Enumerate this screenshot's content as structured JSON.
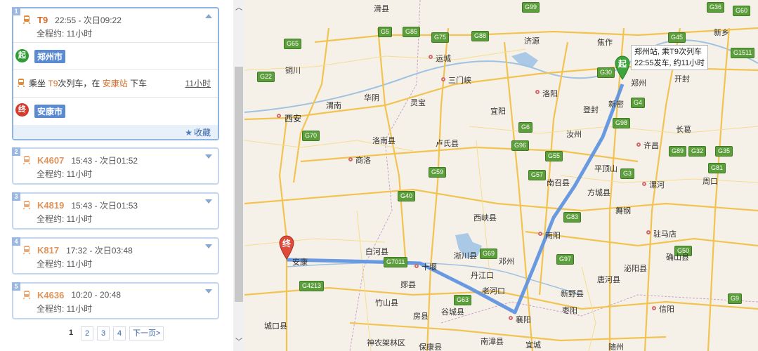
{
  "routes": [
    {
      "index": "1",
      "train": "T9",
      "time": "22:55 - 次日09:22",
      "duration": "全程约: 11小时"
    },
    {
      "index": "2",
      "train": "K4607",
      "time": "15:43 - 次日01:52",
      "duration": "全程约: 11小时"
    },
    {
      "index": "3",
      "train": "K4819",
      "time": "15:43 - 次日01:53",
      "duration": "全程约: 11小时"
    },
    {
      "index": "4",
      "train": "K817",
      "time": "17:32 - 次日03:48",
      "duration": "全程约: 11小时"
    },
    {
      "index": "5",
      "train": "K4636",
      "time": "10:20 - 20:48",
      "duration": "全程约: 11小时"
    }
  ],
  "detail": {
    "start_badge": "起",
    "start_city": "郑州市",
    "ride_prefix": "乘坐",
    "ride_train": "T9",
    "ride_mid": "次列车，在",
    "ride_station": "安康站",
    "ride_suffix": "下车",
    "ride_duration": "11小时",
    "end_badge": "终",
    "end_city": "安康市",
    "favorite": "收藏"
  },
  "pager": {
    "pages": [
      "1",
      "2",
      "3",
      "4"
    ],
    "next": "下一页>"
  },
  "map": {
    "tooltip_line1": "郑州站, 乘T9次列车",
    "tooltip_line2": "22:55发车, 约11小时",
    "start_marker": "起",
    "end_marker": "终",
    "cities": [
      {
        "id": "zhengzhou",
        "label": "郑州"
      },
      {
        "id": "xian",
        "label": "西安"
      },
      {
        "id": "ankang",
        "label": "安康"
      },
      {
        "id": "xiangyang",
        "label": "襄阳"
      },
      {
        "id": "nanyang",
        "label": "南阳"
      },
      {
        "id": "luoyang",
        "label": "洛阳"
      },
      {
        "id": "shiyan",
        "label": "十堰"
      },
      {
        "id": "pingdingshan",
        "label": "平顶山"
      },
      {
        "id": "sanmenxia",
        "label": "三门峡"
      },
      {
        "id": "yuncheng",
        "label": "运城"
      },
      {
        "id": "xuchang",
        "label": "许昌"
      },
      {
        "id": "luohe",
        "label": "漯河"
      },
      {
        "id": "zhumadian",
        "label": "驻马店"
      },
      {
        "id": "xinyang",
        "label": "信阳"
      },
      {
        "id": "shangluo",
        "label": "商洛"
      },
      {
        "id": "jiaozuo",
        "label": "焦作"
      },
      {
        "id": "kaifeng",
        "label": "开封"
      },
      {
        "id": "zhoukou",
        "label": "周口"
      },
      {
        "id": "tongchuan",
        "label": "铜川"
      },
      {
        "id": "weinan",
        "label": "渭南"
      },
      {
        "id": "xinxiang",
        "label": "新乡"
      },
      {
        "id": "danjiangkou",
        "label": "丹江口"
      },
      {
        "id": "laohekou",
        "label": "老河口"
      },
      {
        "id": "suizhou",
        "label": "随州"
      },
      {
        "id": "jiyuan",
        "label": "济源"
      },
      {
        "id": "baihe",
        "label": "白河县"
      },
      {
        "id": "xixia",
        "label": "西峡县"
      },
      {
        "id": "lushi",
        "label": "卢氏县"
      },
      {
        "id": "nanzhao",
        "label": "南召县"
      },
      {
        "id": "zhuzhou",
        "label": "汝州"
      },
      {
        "id": "zaoyang",
        "label": "枣阳"
      },
      {
        "id": "yicheng",
        "label": "宜城"
      },
      {
        "id": "gucheng",
        "label": "谷城县"
      },
      {
        "id": "zhushan",
        "label": "竹山县"
      },
      {
        "id": "fang",
        "label": "房县"
      },
      {
        "id": "chengkou",
        "label": "城口县"
      },
      {
        "id": "xingping",
        "label": "新密"
      },
      {
        "id": "huayin",
        "label": "华阴"
      },
      {
        "id": "luonan",
        "label": "洛南县"
      },
      {
        "id": "lingbao",
        "label": "灵宝"
      },
      {
        "id": "yiyang",
        "label": "宜阳"
      },
      {
        "id": "dengfeng",
        "label": "登封"
      },
      {
        "id": "changge",
        "label": "长葛"
      },
      {
        "id": "queshan",
        "label": "确山县"
      },
      {
        "id": "biyang",
        "label": "泌阳县"
      },
      {
        "id": "tanghe",
        "label": "唐河县"
      },
      {
        "id": "xinye",
        "label": "新野县"
      },
      {
        "id": "dengzhou",
        "label": "邓州"
      },
      {
        "id": "xichuan",
        "label": "淅川县"
      },
      {
        "id": "yunxian",
        "label": "郧县"
      },
      {
        "id": "jiangling",
        "label": "南漳县"
      },
      {
        "id": "baokang",
        "label": "保康县"
      },
      {
        "id": "shennongjia",
        "label": "神农架林区"
      },
      {
        "id": "fangcheng",
        "label": "方城县"
      },
      {
        "id": "wugang",
        "label": "舞钢"
      },
      {
        "id": "huaxian",
        "label": "滑县"
      }
    ],
    "highways": [
      "G5",
      "G65",
      "G70",
      "G30",
      "G40",
      "G55",
      "G4",
      "G45",
      "G59",
      "G36",
      "G85",
      "G75",
      "G88",
      "G96",
      "G99",
      "G83",
      "G98",
      "G6",
      "G69",
      "G22",
      "G7011",
      "G4213",
      "G63",
      "G60",
      "G50",
      "G35",
      "G81",
      "G32",
      "G89",
      "G1511",
      "G3",
      "G57",
      "G97",
      "G9"
    ]
  }
}
